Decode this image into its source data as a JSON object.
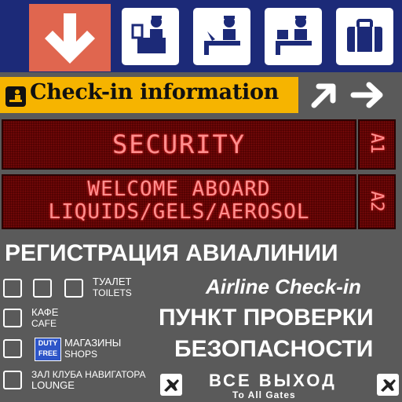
{
  "pictograms": [
    "down-arrow-icon",
    "passport-control-icon",
    "check-in-desk-icon",
    "baggage-claim-icon",
    "suitcase-icon"
  ],
  "checkin": {
    "label": "Check-in information"
  },
  "board1": {
    "text": "SECURITY",
    "side": "A1"
  },
  "board2": {
    "line1": "WELCOME ABOARD",
    "line2": "LIQUIDS/GELS/AEROSOL",
    "side": "A2"
  },
  "headline_ru": "РЕГИСТРАЦИЯ АВИАЛИНИИ",
  "airline_checkin": "Airline Check-in",
  "security_ru_1": "ПУНКТ ПРОВЕРКИ",
  "security_ru_2": "БЕЗОПАСНОСТИ",
  "services": [
    {
      "ru": "ТУАЛЕТ",
      "en": "TOILETS"
    },
    {
      "ru": "КАФЕ",
      "en": "CAFE"
    },
    {
      "ru": "МАГАЗИНЫ",
      "en": "SHOPS"
    },
    {
      "ru": "ЗАЛ КЛУБА НАВИГАТОРА",
      "en": "LOUNGE"
    }
  ],
  "duty_free": {
    "line1": "DUTY",
    "line2": "FREE"
  },
  "gates": {
    "ru": "ВСЕ ВЫХОД",
    "en": "To All Gates"
  },
  "colors": {
    "navy": "#1c2a78",
    "orange_tile": "#e0664f",
    "yellow_bar": "#f6b400",
    "led_bg": "#4b0000",
    "led_text": "#ff8f8f",
    "panel_grey": "#5a5a5a"
  }
}
